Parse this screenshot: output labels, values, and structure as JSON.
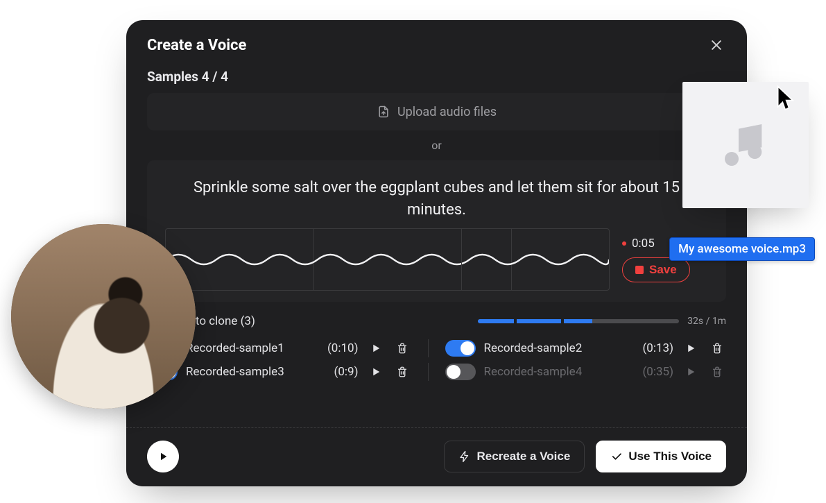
{
  "modal": {
    "title": "Create a Voice",
    "samples_label": "Samples 4 / 4",
    "upload_label": "Upload audio files",
    "or_label": "or",
    "prompt_text": "Sprinkle some salt over the eggplant cubes and let them sit for about 15 minutes.",
    "record_timer": "0:05",
    "save_label": "Save"
  },
  "clones": {
    "header": "Samples to clone (3)",
    "progress_label": "32s / 1m",
    "progress_fill_pct": 53,
    "items": [
      {
        "name": "Recorded-sample1",
        "duration": "(0:10)",
        "enabled": true
      },
      {
        "name": "Recorded-sample2",
        "duration": "(0:13)",
        "enabled": true
      },
      {
        "name": "Recorded-sample3",
        "duration": "(0:9)",
        "enabled": true
      },
      {
        "name": "Recorded-sample4",
        "duration": "(0:35)",
        "enabled": false
      }
    ]
  },
  "footer": {
    "recreate_label": "Recreate a Voice",
    "use_label": "Use This Voice"
  },
  "overlay": {
    "file_name": "My awesome voice.mp3"
  }
}
